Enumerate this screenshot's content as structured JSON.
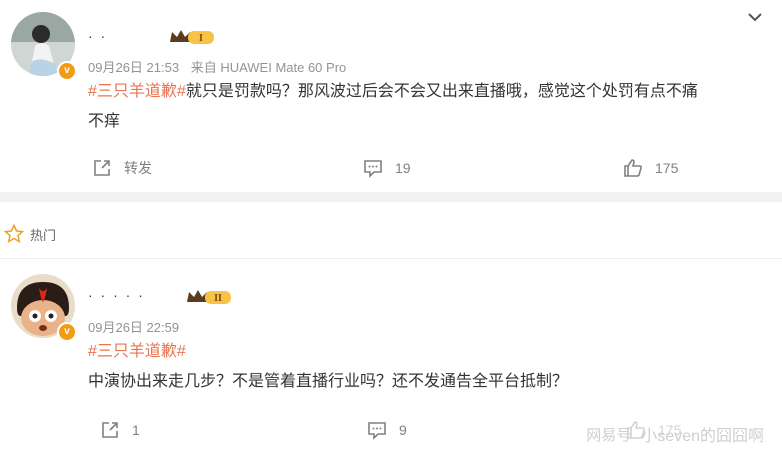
{
  "comments": [
    {
      "username": "· ·",
      "level": "I",
      "timestamp": "09月26日 21:53",
      "source": "来自 HUAWEI Mate 60 Pro",
      "topic": "#三只羊道歉#",
      "text_line1": "就只是罚款吗？那风波过后会不会又出来直播哦，感觉这个处罚有点不痛",
      "text_line2": "不痒",
      "actions": {
        "repost_label": "转发",
        "comment_count": "19",
        "like_count": "175"
      }
    },
    {
      "username": "· · · · ·",
      "level": "II",
      "timestamp": "09月26日 22:59",
      "source": "",
      "topic": "#三只羊道歉#",
      "text_line1": "中演协出来走几步？不是管着直播行业吗？还不发通告全平台抵制？",
      "text_line2": "",
      "actions": {
        "repost_count": "1",
        "comment_count": "9",
        "like_count": "175"
      }
    }
  ],
  "section": {
    "hot_label": "热门"
  },
  "watermark": {
    "brand": "网易号",
    "author": "小seven的囧囧啊"
  },
  "colors": {
    "topic": "#eb7350",
    "accent_badge": "#f39c12"
  }
}
